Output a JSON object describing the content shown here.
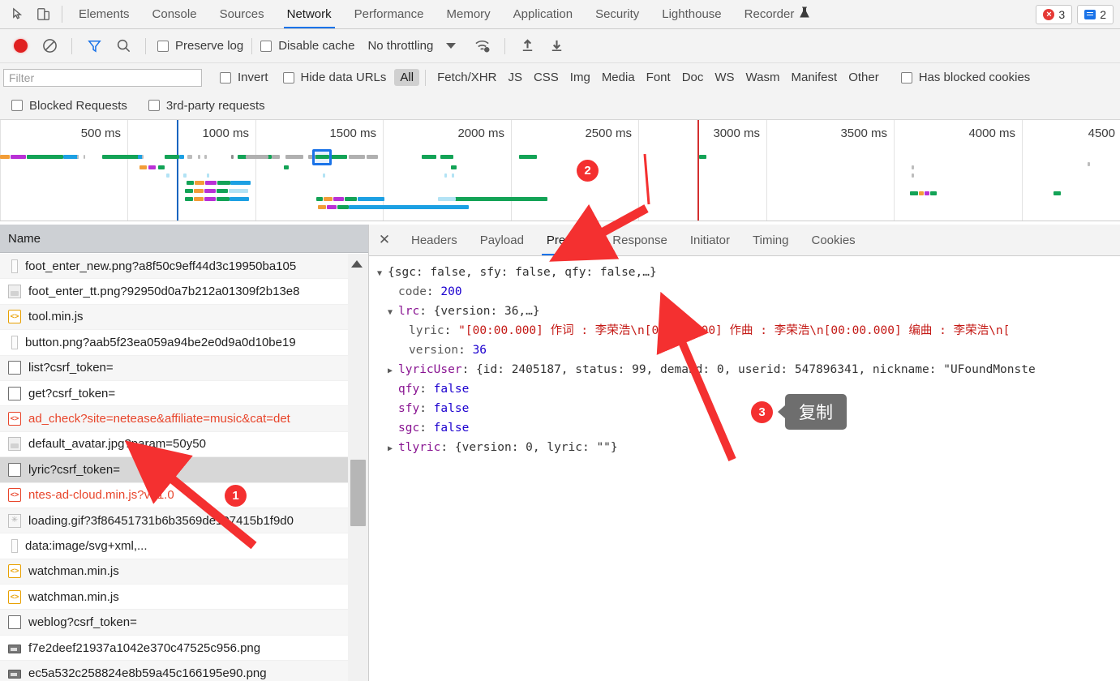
{
  "devtools": {
    "main_tabs": [
      {
        "label": "Elements",
        "active": false
      },
      {
        "label": "Console",
        "active": false
      },
      {
        "label": "Sources",
        "active": false
      },
      {
        "label": "Network",
        "active": true
      },
      {
        "label": "Performance",
        "active": false
      },
      {
        "label": "Memory",
        "active": false
      },
      {
        "label": "Application",
        "active": false
      },
      {
        "label": "Security",
        "active": false
      },
      {
        "label": "Lighthouse",
        "active": false
      },
      {
        "label": "Recorder",
        "active": false
      }
    ],
    "recorder_flask_icon": "flask-icon",
    "error_count": "3",
    "message_count": "2",
    "inspect_icon": "inspect-element-icon",
    "device_icon": "device-toolbar-icon"
  },
  "toolbar": {
    "record_icon": "record-button",
    "clear_icon": "clear-icon",
    "filter_icon": "filter-icon",
    "search_icon": "search-icon",
    "preserve_log": "Preserve log",
    "disable_cache": "Disable cache",
    "throttle": "No throttling",
    "network_conditions_icon": "network-conditions-icon",
    "import_icon": "import-har-icon",
    "export_icon": "export-har-icon"
  },
  "filterbar": {
    "placeholder": "Filter",
    "value": "",
    "invert": "Invert",
    "hide_data_urls": "Hide data URLs",
    "types": [
      {
        "label": "All",
        "active": true
      },
      {
        "label": "Fetch/XHR",
        "active": false
      },
      {
        "label": "JS",
        "active": false
      },
      {
        "label": "CSS",
        "active": false
      },
      {
        "label": "Img",
        "active": false
      },
      {
        "label": "Media",
        "active": false
      },
      {
        "label": "Font",
        "active": false
      },
      {
        "label": "Doc",
        "active": false
      },
      {
        "label": "WS",
        "active": false
      },
      {
        "label": "Wasm",
        "active": false
      },
      {
        "label": "Manifest",
        "active": false
      },
      {
        "label": "Other",
        "active": false
      }
    ],
    "has_blocked_cookies": "Has blocked cookies",
    "blocked_requests": "Blocked Requests",
    "third_party": "3rd-party requests"
  },
  "overview": {
    "ticks": [
      "500 ms",
      "1000 ms",
      "1500 ms",
      "2000 ms",
      "2500 ms",
      "3000 ms",
      "3500 ms",
      "4000 ms",
      "4500"
    ],
    "dom_content_loaded_line_color": "#1565c0",
    "load_line_color": "#d32f2f"
  },
  "requests": {
    "column_header": "Name",
    "rows": [
      {
        "name": "foot_enter_new.png?a8f50c9eff44d3c19950ba105",
        "icon": "image-narrow-icon",
        "error": false,
        "selected": false
      },
      {
        "name": "foot_enter_tt.png?92950d0a7b212a01309f2b13e8",
        "icon": "image-icon",
        "error": false,
        "selected": false
      },
      {
        "name": "tool.min.js",
        "icon": "script-icon",
        "error": false,
        "selected": false
      },
      {
        "name": "button.png?aab5f23ea059a94be2e0d9a0d10be19",
        "icon": "image-narrow-icon",
        "error": false,
        "selected": false
      },
      {
        "name": "list?csrf_token=",
        "icon": "document-icon",
        "error": false,
        "selected": false
      },
      {
        "name": "get?csrf_token=",
        "icon": "document-icon",
        "error": false,
        "selected": false
      },
      {
        "name": "ad_check?site=netease&affiliate=music&cat=det",
        "icon": "script-error-icon",
        "error": true,
        "selected": false
      },
      {
        "name": "default_avatar.jpg?param=50y50",
        "icon": "image-icon",
        "error": false,
        "selected": false
      },
      {
        "name": "lyric?csrf_token=",
        "icon": "document-icon",
        "error": false,
        "selected": true
      },
      {
        "name": "ntes-ad-cloud.min.js?v=1.0",
        "icon": "script-error-icon",
        "error": true,
        "selected": false
      },
      {
        "name": "loading.gif?3f86451731b6b3569de107415b1f9d0",
        "icon": "gif-icon",
        "error": false,
        "selected": false
      },
      {
        "name": "data:image/svg+xml,...",
        "icon": "image-narrow-icon",
        "error": false,
        "selected": false
      },
      {
        "name": "watchman.min.js",
        "icon": "script-icon",
        "error": false,
        "selected": false
      },
      {
        "name": "watchman.min.js",
        "icon": "script-icon",
        "error": false,
        "selected": false
      },
      {
        "name": "weblog?csrf_token=",
        "icon": "document-icon",
        "error": false,
        "selected": false
      },
      {
        "name": "f7e2deef21937a1042e370c47525c956.png",
        "icon": "image-dark-icon",
        "error": false,
        "selected": false
      },
      {
        "name": "ec5a532c258824e8b59a45c166195e90.png",
        "icon": "image-dark-icon",
        "error": false,
        "selected": false
      }
    ]
  },
  "detail": {
    "close_icon": "close-icon",
    "tabs": [
      {
        "label": "Headers",
        "active": false
      },
      {
        "label": "Payload",
        "active": false
      },
      {
        "label": "Preview",
        "active": true
      },
      {
        "label": "Response",
        "active": false
      },
      {
        "label": "Initiator",
        "active": false
      },
      {
        "label": "Timing",
        "active": false
      },
      {
        "label": "Cookies",
        "active": false
      }
    ],
    "preview": {
      "root_summary": "{sgc: false, sfy: false, qfy: false,…}",
      "lines": [
        {
          "id": "root",
          "indent": 0,
          "triangle": "▼",
          "text": "{sgc: false, sfy: false, qfy: false,…}"
        },
        {
          "id": "code",
          "indent": 1,
          "triangle": "",
          "key": "code",
          "sep": ": ",
          "value": "200",
          "value_type": "number"
        },
        {
          "id": "lrc",
          "indent": 1,
          "triangle": "▼",
          "key": "lrc",
          "sep": ": ",
          "value": "{version: 36,…}",
          "value_type": "summary"
        },
        {
          "id": "lyric",
          "indent": 2,
          "triangle": "",
          "key": "lyric",
          "sep": ": ",
          "value": "\"[00:00.000] 作词 : 李荣浩\\n[00:00.000] 作曲 : 李荣浩\\n[00:00.000] 编曲 : 李荣浩\\n[",
          "value_type": "string"
        },
        {
          "id": "version",
          "indent": 2,
          "triangle": "",
          "key": "version",
          "sep": ": ",
          "value": "36",
          "value_type": "number"
        },
        {
          "id": "lyricUser",
          "indent": 1,
          "triangle": "▶",
          "key": "lyricUser",
          "sep": ": ",
          "value": "{id: 2405187, status: 99, demand: 0, userid: 547896341, nickname: \"UFoundMonste",
          "value_type": "summary"
        },
        {
          "id": "qfy",
          "indent": 1,
          "triangle": "",
          "key": "qfy",
          "sep": ": ",
          "value": "false",
          "value_type": "bool"
        },
        {
          "id": "sfy",
          "indent": 1,
          "triangle": "",
          "key": "sfy",
          "sep": ": ",
          "value": "false",
          "value_type": "bool"
        },
        {
          "id": "sgc",
          "indent": 1,
          "triangle": "",
          "key": "sgc",
          "sep": ": ",
          "value": "false",
          "value_type": "bool"
        },
        {
          "id": "tlyric",
          "indent": 1,
          "triangle": "▶",
          "key": "tlyric",
          "sep": ": ",
          "value": "{version: 0, lyric: \"\"}",
          "value_type": "summary"
        }
      ]
    }
  },
  "annotations": {
    "badge1": "1",
    "badge2": "2",
    "badge3": "3",
    "tooltip3": "复制",
    "arrow_color": "#f43030"
  }
}
